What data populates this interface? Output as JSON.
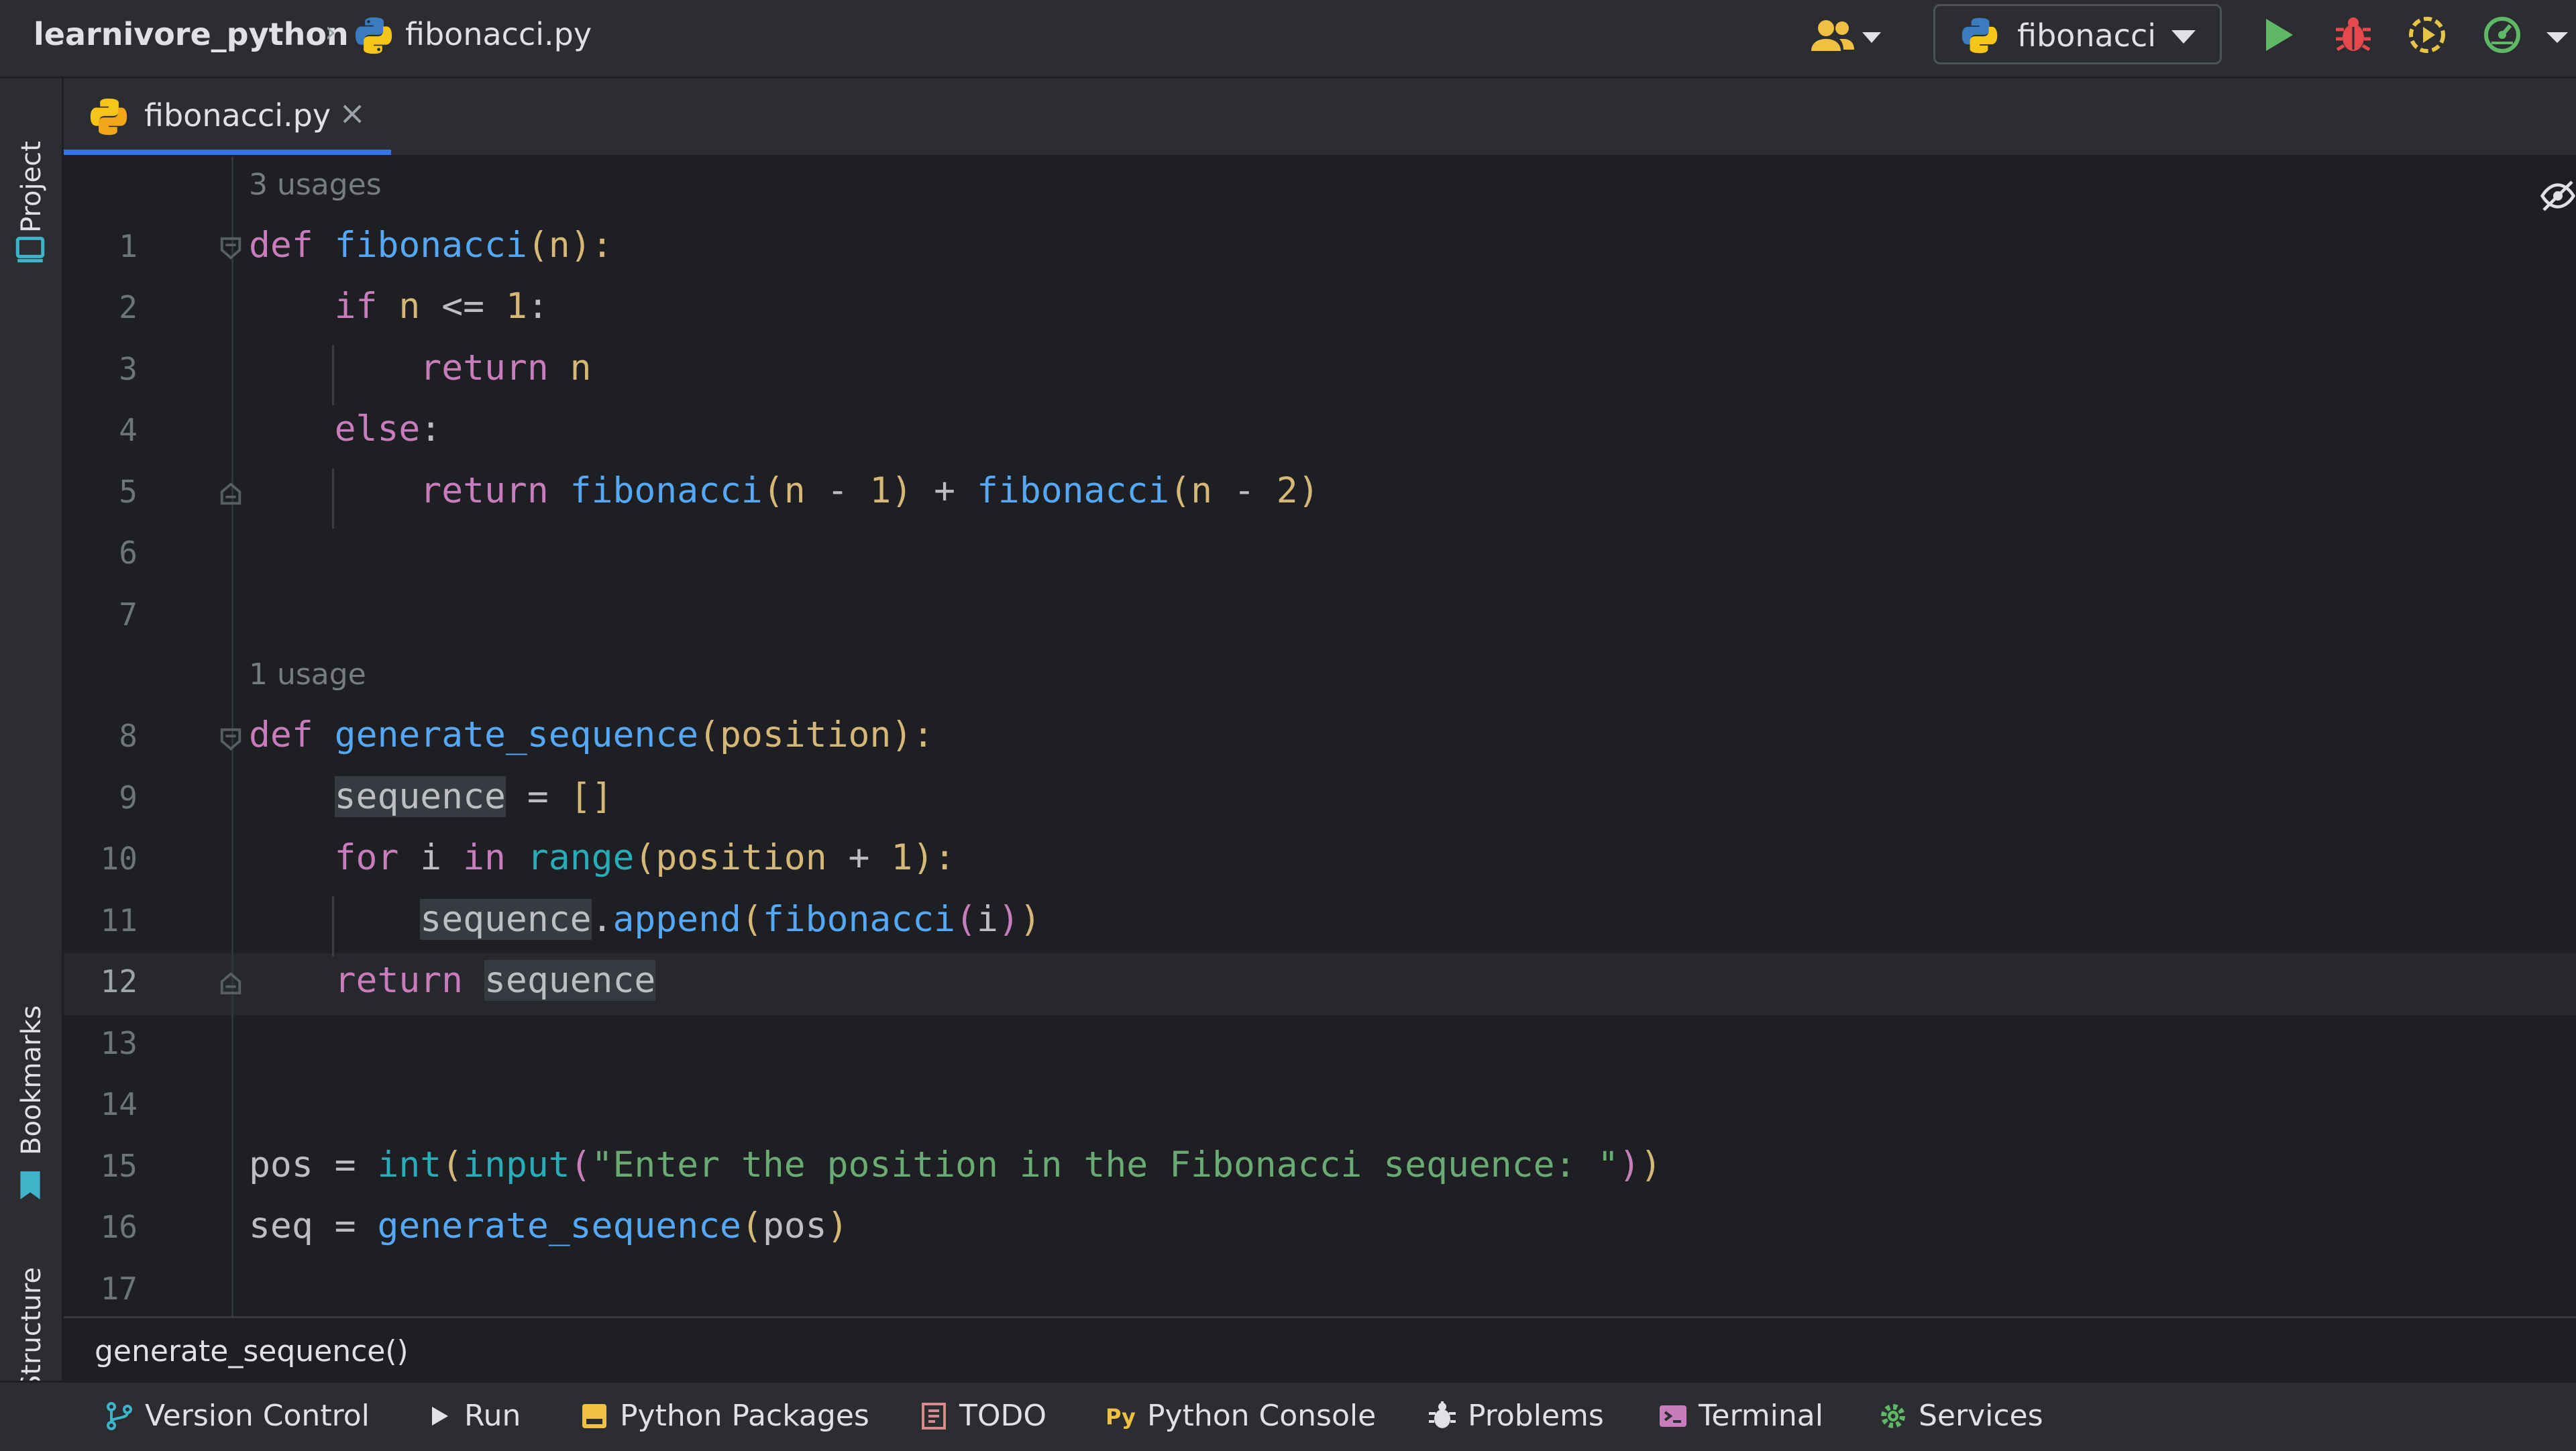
{
  "titlebar": {
    "project": "learnivore_python",
    "separator": "›",
    "file": "fibonacci.py",
    "run_config": "fibonacci"
  },
  "left_tools": [
    "Project",
    "Bookmarks",
    "Structure"
  ],
  "tab": {
    "label": "fibonacci.py",
    "close": "×"
  },
  "editor": {
    "hints": [
      "3 usages",
      "1 usage"
    ],
    "line_numbers": [
      "1",
      "2",
      "3",
      "4",
      "5",
      "6",
      "7",
      "8",
      "9",
      "10",
      "11",
      "12",
      "13",
      "14",
      "15",
      "16",
      "17"
    ],
    "active_line": "12",
    "code": {
      "l1": {
        "kw": "def",
        "fn": "fibonacci",
        "open": "(",
        "param": "n",
        "close": "):"
      },
      "l2": {
        "kw": "if",
        "var": "n",
        "op": " <= ",
        "num": "1",
        "end": ":"
      },
      "l3": {
        "kw": "return",
        "var": "n"
      },
      "l4": {
        "kw": "else",
        "end": ":"
      },
      "l5": {
        "kw": "return",
        "fn1": "fibonacci",
        "o1": "(",
        "v1": "n",
        "op1": " - ",
        "n1": "1",
        "c1": ")",
        "plus": " + ",
        "fn2": "fibonacci",
        "o2": "(",
        "v2": "n",
        "op2": " - ",
        "n2": "2",
        "c2": ")"
      },
      "l8": {
        "kw": "def",
        "fn": "generate_sequence",
        "open": "(",
        "param": "position",
        "close": "):"
      },
      "l9": {
        "var": "sequence",
        "eq": " = ",
        "lst": "[]"
      },
      "l10": {
        "kw": "for",
        "var": "i",
        "kw2": "in",
        "bi": "range",
        "open": "(",
        "param": "position",
        "op": " + ",
        "num": "1",
        "close": "):"
      },
      "l11": {
        "var": "sequence",
        "dot": ".",
        "method": "append",
        "o1": "(",
        "fn": "fibonacci",
        "o2": "(",
        "arg": "i",
        "c2": ")",
        "c1": ")"
      },
      "l12": {
        "kw": "return",
        "var": "sequence"
      },
      "l15": {
        "var": "pos",
        "eq": " = ",
        "bi1": "int",
        "o1": "(",
        "bi2": "input",
        "o2": "(",
        "str": "\"Enter the position in the Fibonacci sequence: \"",
        "c2": ")",
        "c1": ")"
      },
      "l16": {
        "var": "seq",
        "eq": " = ",
        "fn": "generate_sequence",
        "o": "(",
        "arg": "pos",
        "c": ")"
      }
    }
  },
  "breadcrumb": "generate_sequence()",
  "bottom_tools": [
    "Version Control",
    "Run",
    "Python Packages",
    "TODO",
    "Python Console",
    "Problems",
    "Terminal",
    "Services"
  ],
  "colors": {
    "keyword": "#cf8e6d",
    "function": "#56a8f5",
    "number": "#2aacb8",
    "string": "#6aab73",
    "accent": "#3574f0",
    "run": "#5fb865",
    "debug": "#e5484d"
  }
}
